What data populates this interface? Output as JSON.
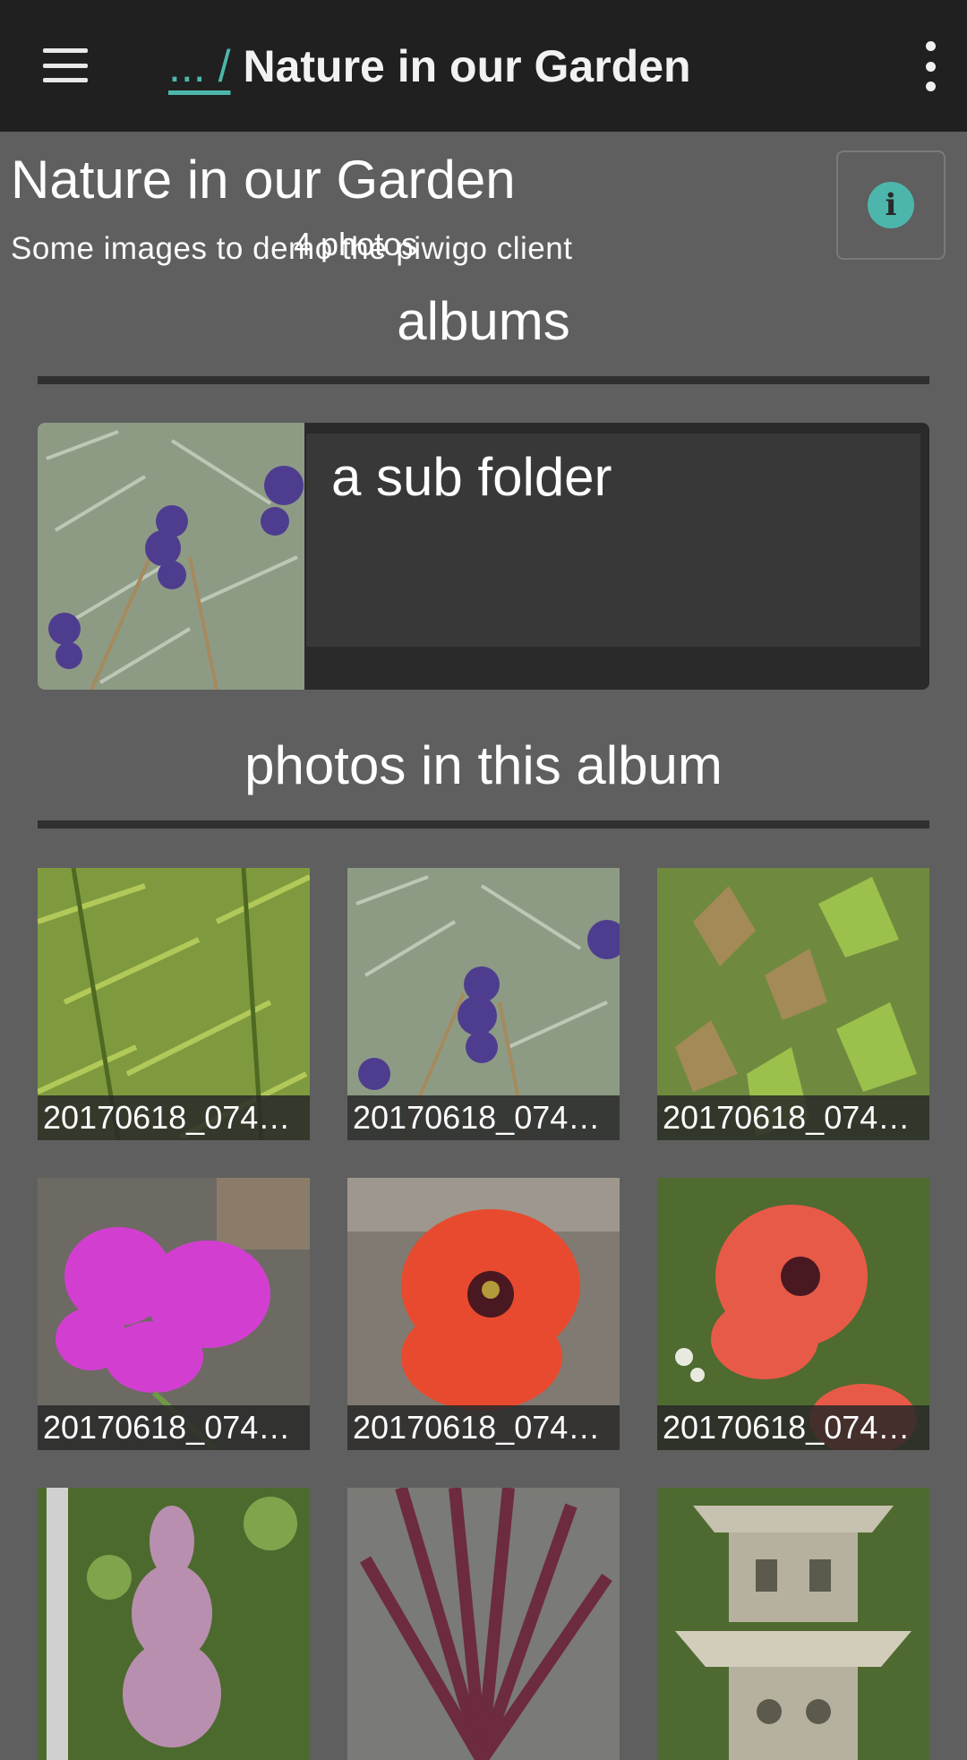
{
  "appbar": {
    "breadcrumb_link": "... /",
    "title": "Nature in our Garden",
    "menu_icon": "hamburger-menu-icon",
    "overflow_icon": "more-vert-icon"
  },
  "album": {
    "title": "Nature in our Garden",
    "description": "Some images to demo the piwigo client",
    "info_icon": "info-icon",
    "info_glyph": "i"
  },
  "sections": {
    "albums_heading": "albums",
    "photos_heading": "photos in this album"
  },
  "subalbums": [
    {
      "name": "a sub folder",
      "count": "4 photos",
      "thumb": "lavender"
    }
  ],
  "photos": [
    {
      "caption": "20170618_074…",
      "thumb": "bamboo"
    },
    {
      "caption": "20170618_074…",
      "thumb": "lavender"
    },
    {
      "caption": "20170618_074…",
      "thumb": "maple"
    },
    {
      "caption": "20170618_074…",
      "thumb": "sweet-pea"
    },
    {
      "caption": "20170618_074…",
      "thumb": "poppy"
    },
    {
      "caption": "20170618_074…",
      "thumb": "poppy-garden"
    },
    {
      "caption": "",
      "thumb": "foxglove"
    },
    {
      "caption": "",
      "thumb": "cordyline"
    },
    {
      "caption": "",
      "thumb": "stone-lantern"
    }
  ],
  "colors": {
    "appbar": "#202020",
    "background": "#5f5f5f",
    "accent": "#4db6ac"
  }
}
